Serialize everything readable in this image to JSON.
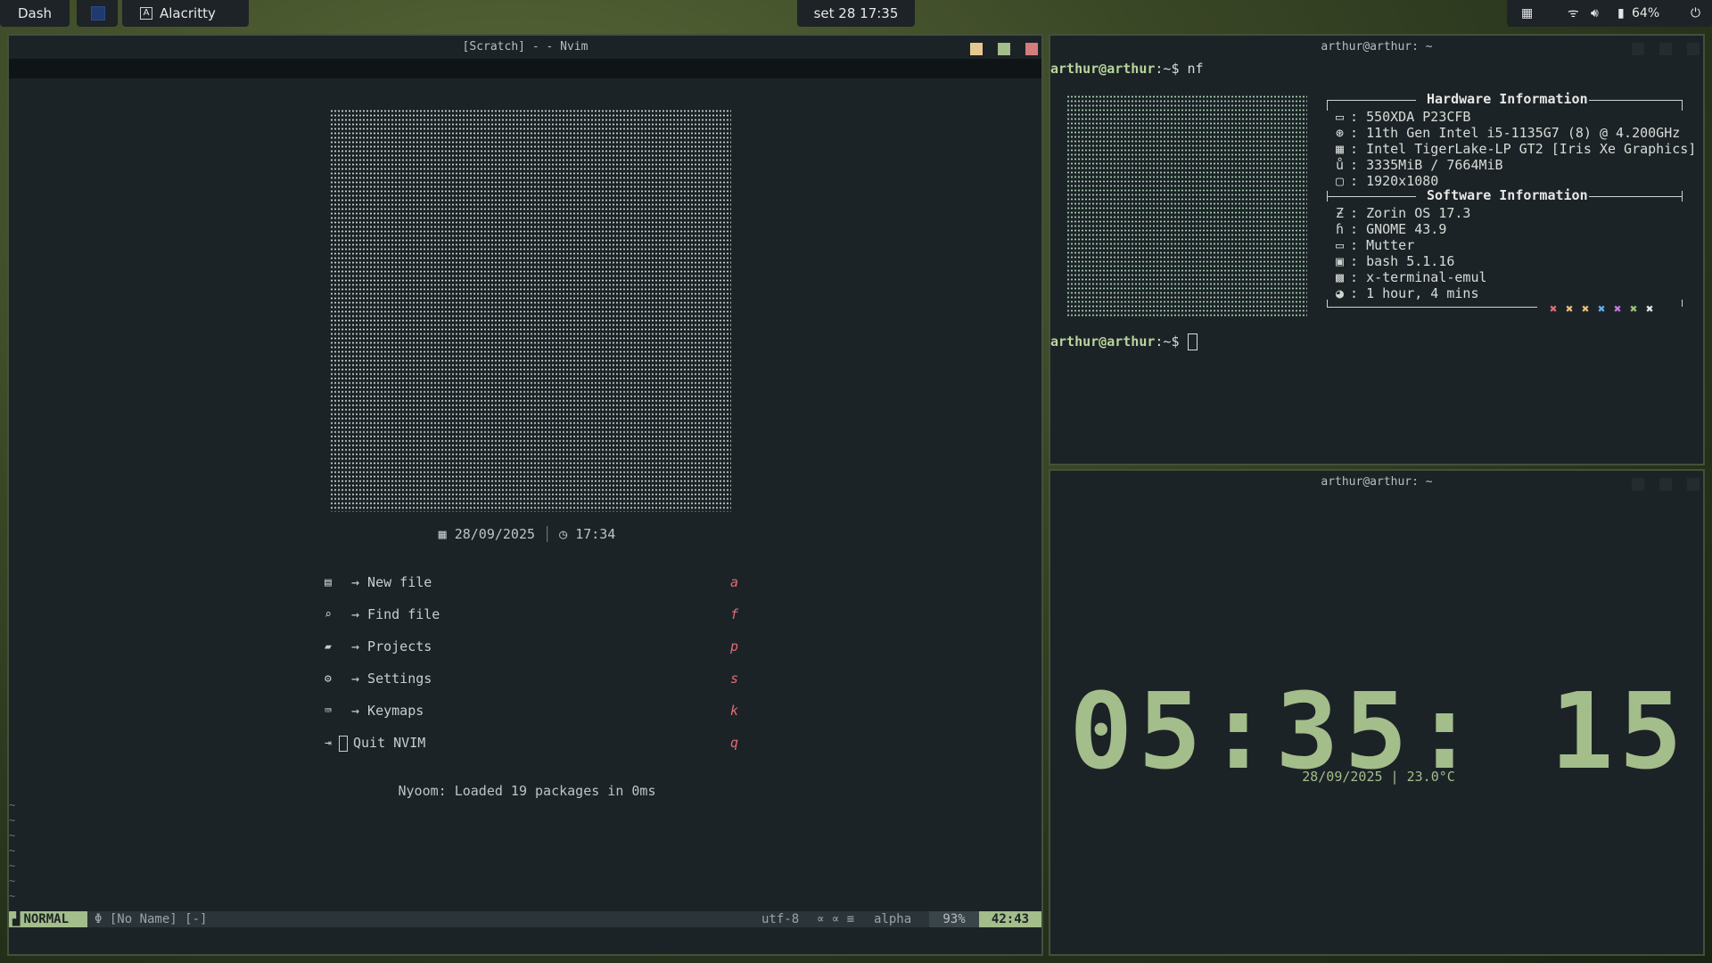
{
  "topbar": {
    "dash": "Dash",
    "app_icon": "A",
    "app_title": "Alacritty",
    "clock": "set 28 17:35",
    "battery": "64%"
  },
  "nvim": {
    "title": "[Scratch] - - Nvim",
    "date": "28/09/2025",
    "time": "17:34",
    "menu": [
      {
        "label": "→ New file",
        "key": "a",
        "icon": "file-icon"
      },
      {
        "label": "→ Find file",
        "key": "f",
        "icon": "search-file-icon"
      },
      {
        "label": "→ Projects",
        "key": "p",
        "icon": "folder-icon"
      },
      {
        "label": "→ Settings",
        "key": "s",
        "icon": "gear-icon"
      },
      {
        "label": "→ Keymaps",
        "key": "k",
        "icon": "keyboard-icon"
      },
      {
        "label": "Quit NVIM",
        "key": "q",
        "icon": "quit-icon"
      }
    ],
    "footer": "Nyoom: Loaded 19 packages in 0ms",
    "status": {
      "mode": "NORMAL",
      "buffer": "[No Name] [-]",
      "encoding": "utf-8",
      "filetype": "alpha",
      "percent": "93%",
      "position": "42:43"
    }
  },
  "term1": {
    "title": "arthur@arthur: ~",
    "prompt_user": "arthur@arthur",
    "prompt_path": ":~$ ",
    "command": "nf",
    "hardware_header": "Hardware Information",
    "software_header": "Software Information",
    "hardware": [
      "550XDA P23CFB",
      "11th Gen Intel i5-1135G7 (8) @ 4.200GHz",
      "Intel TigerLake-LP GT2 [Iris Xe Graphics]",
      "3335MiB / 7664MiB",
      "1920x1080"
    ],
    "software": [
      "Zorin OS 17.3",
      "GNOME 43.9",
      "Mutter",
      "bash 5.1.16",
      "x-terminal-emul",
      "1 hour, 4 mins"
    ],
    "palette": [
      "#e06c75",
      "#e5c07b",
      "#e5c07b",
      "#61afef",
      "#c678dd",
      "#98c379",
      "#e6e6e6"
    ]
  },
  "term2": {
    "title": "arthur@arthur: ~",
    "clock": "05:35: 15",
    "date_temp": "28/09/2025 | 23.0°C"
  }
}
